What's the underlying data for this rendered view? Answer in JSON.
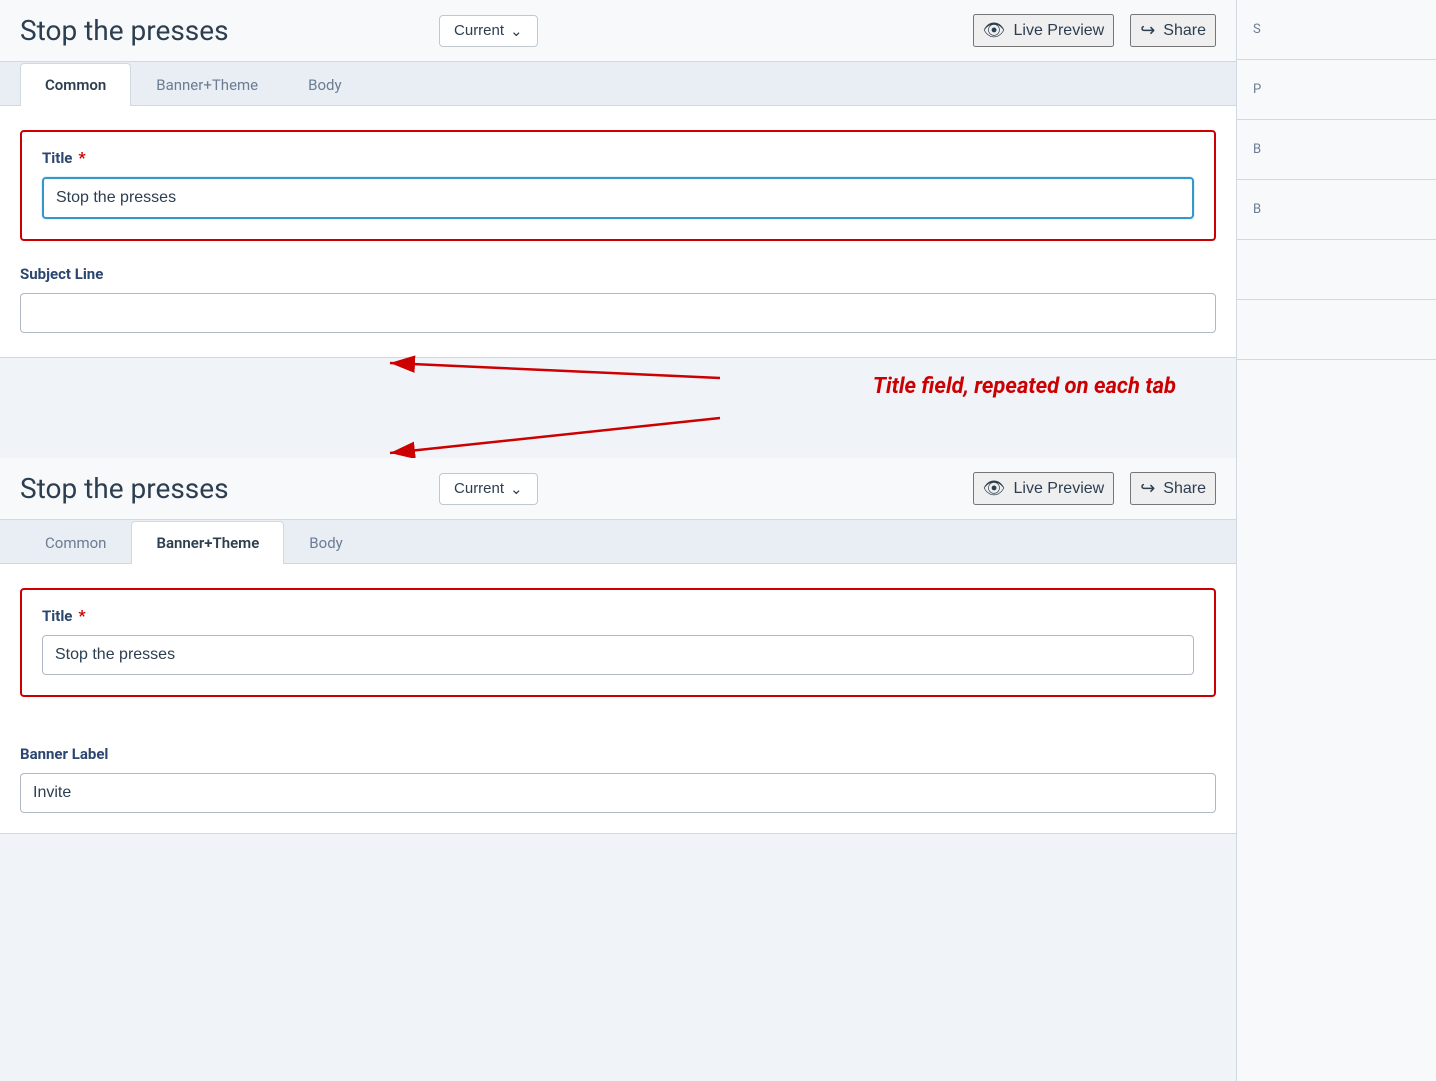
{
  "app": {
    "title": "Stop the presses"
  },
  "header": {
    "title": "Stop the presses",
    "dropdown_label": "Current",
    "dropdown_icon": "chevron-down",
    "live_preview_label": "Live Preview",
    "share_label": "Share"
  },
  "tabs": {
    "top": [
      {
        "id": "common",
        "label": "Common",
        "active": true
      },
      {
        "id": "banner_theme",
        "label": "Banner+Theme",
        "active": false
      },
      {
        "id": "body",
        "label": "Body",
        "active": false
      }
    ],
    "bottom": [
      {
        "id": "common",
        "label": "Common",
        "active": false
      },
      {
        "id": "banner_theme",
        "label": "Banner+Theme",
        "active": true
      },
      {
        "id": "body",
        "label": "Body",
        "active": false
      }
    ]
  },
  "panel_top": {
    "title_label": "Title",
    "title_required": "*",
    "title_value": "Stop the presses",
    "subject_label": "Subject Line",
    "subject_value": "",
    "subject_placeholder": ""
  },
  "panel_bottom": {
    "title_label": "Title",
    "title_required": "*",
    "title_value": "Stop the presses",
    "banner_label": "Banner Label",
    "banner_value": "Invite"
  },
  "annotation": {
    "text": "Title field, repeated on each tab"
  },
  "right_panel": {
    "items": [
      "S",
      "P",
      "B",
      "B"
    ]
  },
  "icons": {
    "eye": "👁",
    "share": "↪",
    "chevron_down": "∨"
  }
}
